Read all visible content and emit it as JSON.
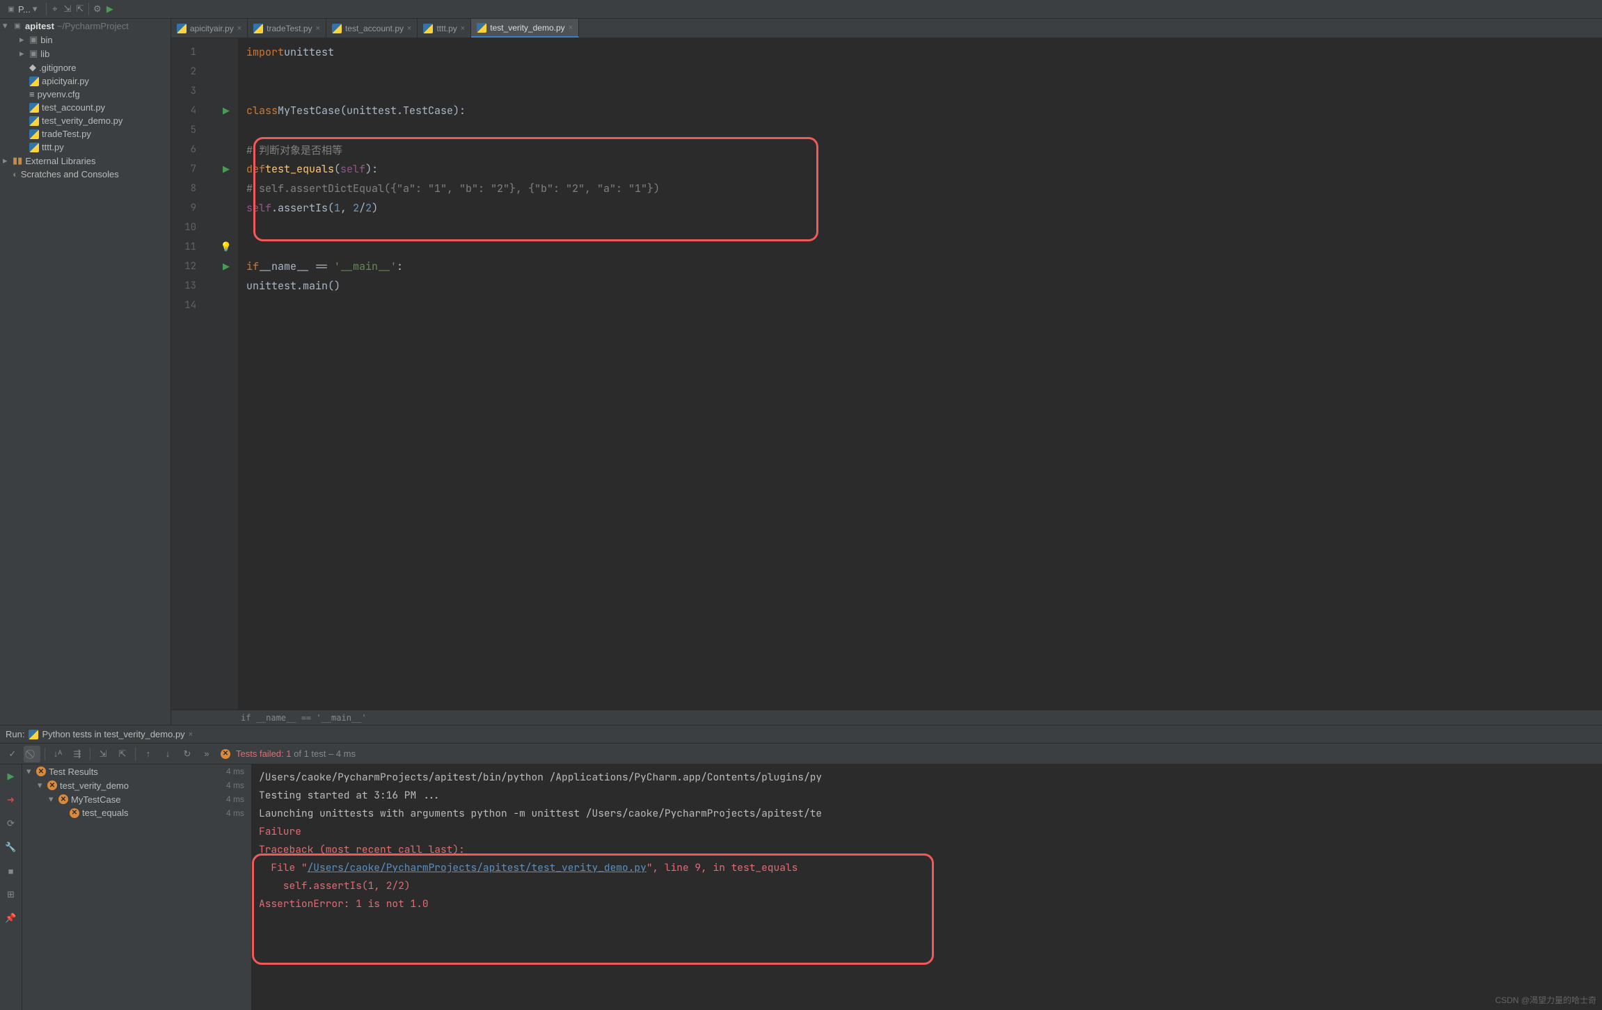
{
  "toolbar": {
    "project_btn": "P...",
    "gear": "⚙︎"
  },
  "sidebar": {
    "root": "apitest",
    "root_path": "~/PycharmProject",
    "items": [
      {
        "indent": 1,
        "chev": "▸",
        "icon": "📁",
        "label": "bin"
      },
      {
        "indent": 1,
        "chev": "▸",
        "icon": "📁",
        "label": "lib"
      },
      {
        "indent": 1,
        "chev": "",
        "icon": "◆",
        ".gitignore": true,
        "label": ".gitignore"
      },
      {
        "indent": 1,
        "chev": "",
        "icon": "py",
        "label": "apicityair.py"
      },
      {
        "indent": 1,
        "chev": "",
        "icon": "≡",
        "label": "pyvenv.cfg"
      },
      {
        "indent": 1,
        "chev": "",
        "icon": "py",
        "label": "test_account.py"
      },
      {
        "indent": 1,
        "chev": "",
        "icon": "py",
        "label": "test_verity_demo.py"
      },
      {
        "indent": 1,
        "chev": "",
        "icon": "py",
        "label": "tradeTest.py"
      },
      {
        "indent": 1,
        "chev": "",
        "icon": "py",
        "label": "tttt.py"
      }
    ],
    "ext_lib": "External Libraries",
    "scratch": "Scratches and Consoles"
  },
  "tabs": [
    {
      "label": "apicityair.py",
      "active": false
    },
    {
      "label": "tradeTest.py",
      "active": false
    },
    {
      "label": "test_account.py",
      "active": false
    },
    {
      "label": "tttt.py",
      "active": false
    },
    {
      "label": "test_verity_demo.py",
      "active": true
    }
  ],
  "linenos": [
    "1",
    "2",
    "3",
    "4",
    "5",
    "6",
    "7",
    "8",
    "9",
    "10",
    "11",
    "12",
    "13",
    "14"
  ],
  "gutter_run": {
    "4": true,
    "7": true,
    "12": true
  },
  "gutter_bulb": {
    "11": true
  },
  "code_html": [
    "<span class='kw'>import</span> <span class='txt'>unittest</span>",
    "",
    "",
    "<span class='kw'>class</span> <span class='cls'>MyTestCase</span><span class='txt'>(unittest.TestCase):</span>",
    "",
    "    <span class='cmt'># 判断对象是否相等</span>",
    "    <span class='kw'>def</span> <span class='fn'>test_equals</span><span class='txt'>(</span><span class='self'>self</span><span class='txt'>):</span>",
    "        <span class='cmt'># self.assertDictEqual({\"a\": \"1\", \"b\": \"2\"}, {\"b\": \"2\", \"a\": \"1\"})</span>",
    "        <span class='self'>self</span><span class='txt'>.assertIs(</span><span class='num'>1</span><span class='txt'>, </span><span class='num'>2</span><span class='txt'>/</span><span class='num'>2</span><span class='txt'>)</span>",
    "",
    "",
    "<span class='kw'>if</span> <span class='txt'>__name__ == </span><span class='str'>'__main__'</span><span class='txt'>:</span>",
    "    <span class='txt'>unittest.main()</span>",
    ""
  ],
  "breadcrumb": "if __name__ == '__main__'",
  "run": {
    "header_label": "Run:",
    "config_name": "Python tests in test_verity_demo.py",
    "fail_text": "Tests failed: 1",
    "fail_suffix": " of 1 test – 4 ms"
  },
  "results": [
    {
      "indent": 0,
      "label": "Test Results",
      "time": "4 ms"
    },
    {
      "indent": 1,
      "label": "test_verity_demo",
      "time": "4 ms"
    },
    {
      "indent": 2,
      "label": "MyTestCase",
      "time": "4 ms"
    },
    {
      "indent": 3,
      "label": "test_equals",
      "time": "4 ms"
    }
  ],
  "console": [
    {
      "t": "/Users/caoke/PycharmProjects/apitest/bin/python /Applications/PyCharm.app/Contents/plugins/py"
    },
    {
      "t": "Testing started at 3:16 PM ..."
    },
    {
      "t": "Launching unittests with arguments python -m unittest /Users/caoke/PycharmProjects/apitest/te"
    },
    {
      "t": ""
    },
    {
      "t": ""
    },
    {
      "cls": "err",
      "t": "Failure"
    },
    {
      "cls": "err",
      "t": "Traceback (most recent call last):"
    },
    {
      "cls": "err",
      "html": "  File \"<span class='lnk'>/Users/caoke/PycharmProjects/apitest/test_verity_demo.py</span>\", line 9, in test_equals"
    },
    {
      "cls": "err",
      "t": "    self.assertIs(1, 2/2)"
    },
    {
      "cls": "err",
      "t": "AssertionError: 1 is not 1.0"
    }
  ],
  "watermark": "CSDN @渴望力量的哈士奇"
}
